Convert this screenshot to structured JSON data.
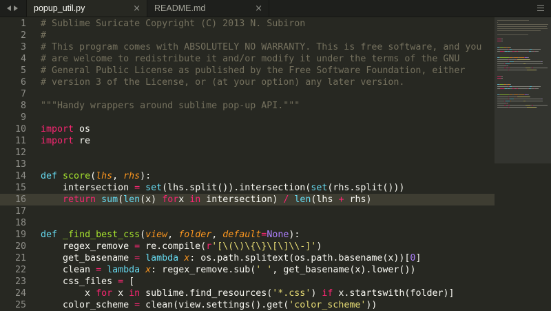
{
  "tabs": [
    {
      "label": "popup_util.py",
      "close": "×"
    },
    {
      "label": "README.md",
      "close": "×"
    }
  ],
  "lines": [
    {
      "n": "1",
      "tokens": [
        [
          "c",
          "# Sublime Suricate Copyright (C) 2013 N. Subiron"
        ]
      ]
    },
    {
      "n": "2",
      "tokens": [
        [
          "c",
          "#"
        ]
      ]
    },
    {
      "n": "3",
      "tokens": [
        [
          "c",
          "# This program comes with ABSOLUTELY NO WARRANTY. This is free software, and you"
        ]
      ]
    },
    {
      "n": "4",
      "tokens": [
        [
          "c",
          "# are welcome to redistribute it and/or modify it under the terms of the GNU"
        ]
      ]
    },
    {
      "n": "5",
      "tokens": [
        [
          "c",
          "# General Public License as published by the Free Software Foundation, either"
        ]
      ]
    },
    {
      "n": "6",
      "tokens": [
        [
          "c",
          "# version 3 of the License, or (at your option) any later version."
        ]
      ]
    },
    {
      "n": "7",
      "tokens": []
    },
    {
      "n": "8",
      "tokens": [
        [
          "c",
          "\"\"\"Handy wrappers around sublime pop-up API.\"\"\""
        ]
      ]
    },
    {
      "n": "9",
      "tokens": []
    },
    {
      "n": "10",
      "tokens": [
        [
          "k",
          "import"
        ],
        [
          "",
          "os"
        ]
      ]
    },
    {
      "n": "11",
      "tokens": [
        [
          "k",
          "import"
        ],
        [
          "",
          "re"
        ]
      ]
    },
    {
      "n": "12",
      "tokens": []
    },
    {
      "n": "13",
      "tokens": []
    },
    {
      "n": "14",
      "tokens": [
        [
          "b",
          "def"
        ],
        [
          "",
          " "
        ],
        [
          "f",
          "score"
        ],
        [
          "",
          "("
        ],
        [
          "p",
          "lhs"
        ],
        [
          "",
          ", "
        ],
        [
          "p",
          "rhs"
        ],
        [
          "",
          "):"
        ]
      ]
    },
    {
      "n": "15",
      "tokens": [
        [
          "",
          "    intersection "
        ],
        [
          "k",
          "="
        ],
        [
          "",
          " "
        ],
        [
          "b",
          "set"
        ],
        [
          "",
          "(lhs.split()).intersection("
        ],
        [
          "b",
          "set"
        ],
        [
          "",
          "(rhs.split()))"
        ]
      ]
    },
    {
      "n": "16",
      "cur": true,
      "tokens": [
        [
          "",
          "    "
        ],
        [
          "k",
          "return"
        ],
        [
          "",
          " "
        ],
        [
          "b",
          "sum"
        ],
        [
          "",
          "("
        ],
        [
          "b",
          "len"
        ],
        [
          "",
          "(x) "
        ],
        [
          "k",
          "for"
        ],
        [
          "",
          "",
          " "
        ],
        [
          "",
          "x "
        ],
        [
          "k",
          "in"
        ],
        [
          "",
          " intersection) "
        ],
        [
          "k",
          "/"
        ],
        [
          "",
          " "
        ],
        [
          "b",
          "len"
        ],
        [
          "",
          "(lhs "
        ],
        [
          "k",
          "+"
        ],
        [
          "",
          " rhs)"
        ]
      ]
    },
    {
      "n": "17",
      "tokens": []
    },
    {
      "n": "18",
      "tokens": []
    },
    {
      "n": "19",
      "tokens": [
        [
          "b",
          "def"
        ],
        [
          "",
          " "
        ],
        [
          "f",
          "_find_best_css"
        ],
        [
          "",
          "("
        ],
        [
          "p",
          "view"
        ],
        [
          "",
          ", "
        ],
        [
          "p",
          "folder"
        ],
        [
          "",
          ", "
        ],
        [
          "p",
          "default"
        ],
        [
          "k",
          "="
        ],
        [
          "n",
          "None"
        ],
        [
          "",
          "):"
        ]
      ]
    },
    {
      "n": "20",
      "tokens": [
        [
          "",
          "    regex_remove "
        ],
        [
          "k",
          "="
        ],
        [
          "",
          " re.compile("
        ],
        [
          "k",
          "r"
        ],
        [
          "s",
          "'[\\(\\)\\{\\}\\[\\]\\\\-]'"
        ],
        [
          "",
          ")"
        ]
      ]
    },
    {
      "n": "21",
      "tokens": [
        [
          "",
          "    get_basename "
        ],
        [
          "k",
          "="
        ],
        [
          "",
          " "
        ],
        [
          "b",
          "lambda"
        ],
        [
          "",
          " "
        ],
        [
          "p",
          "x"
        ],
        [
          "",
          ": os.path.splitext(os.path.basename(x))["
        ],
        [
          "n",
          "0"
        ],
        [
          "",
          "]"
        ]
      ]
    },
    {
      "n": "22",
      "tokens": [
        [
          "",
          "    clean "
        ],
        [
          "k",
          "="
        ],
        [
          "",
          " "
        ],
        [
          "b",
          "lambda"
        ],
        [
          "",
          " "
        ],
        [
          "p",
          "x"
        ],
        [
          "",
          ": regex_remove.sub("
        ],
        [
          "s",
          "' '"
        ],
        [
          "",
          ", get_basename(x).lower())"
        ]
      ]
    },
    {
      "n": "23",
      "tokens": [
        [
          "",
          "    css_files "
        ],
        [
          "k",
          "="
        ],
        [
          "",
          " ["
        ]
      ]
    },
    {
      "n": "24",
      "tokens": [
        [
          "",
          "        x "
        ],
        [
          "k",
          "for"
        ],
        [
          "",
          " x "
        ],
        [
          "k",
          "in"
        ],
        [
          "",
          " sublime.find_resources("
        ],
        [
          "s",
          "'*.css'"
        ],
        [
          "",
          ") "
        ],
        [
          "k",
          "if"
        ],
        [
          "",
          " x.startswith(folder)]"
        ]
      ]
    },
    {
      "n": "25",
      "tokens": [
        [
          "",
          "    color_scheme "
        ],
        [
          "k",
          "="
        ],
        [
          "",
          " clean(view.settings().get("
        ],
        [
          "s",
          "'color_scheme'"
        ],
        [
          "",
          "))"
        ]
      ]
    }
  ]
}
